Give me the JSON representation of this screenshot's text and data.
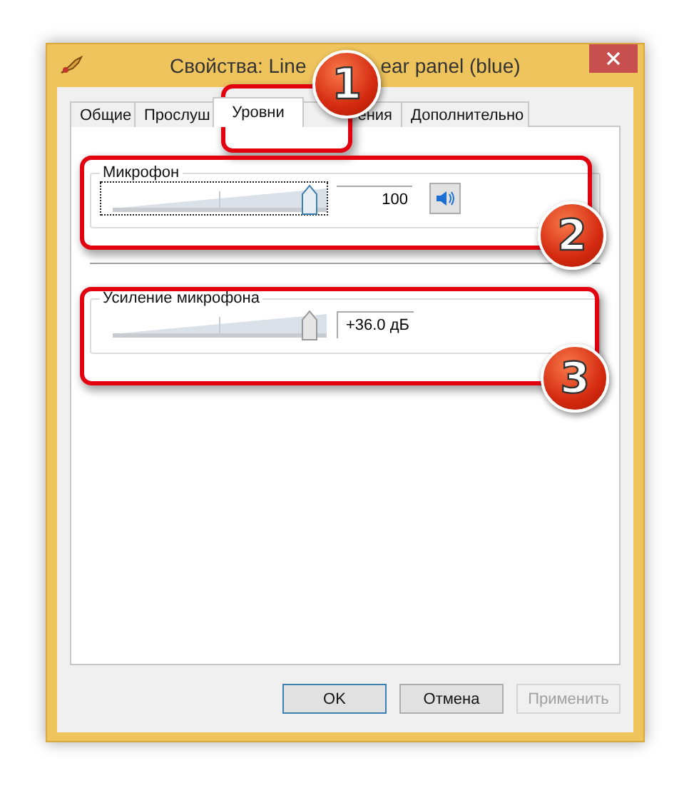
{
  "window": {
    "title_parts": [
      "Свойства: Line",
      "ear panel (blue)"
    ]
  },
  "tabs": [
    {
      "label": "Общие",
      "selected": false
    },
    {
      "label": "Прослуш",
      "selected": false
    },
    {
      "label": "Уровни",
      "selected": true
    },
    {
      "label": "ения",
      "selected": false
    },
    {
      "label": "Дополнительно",
      "selected": false
    }
  ],
  "groups": [
    {
      "label": "Микрофон",
      "kind": "volume",
      "level": 1,
      "reading": "100",
      "muted": false
    },
    {
      "label": "Усиление микрофона",
      "kind": "boost",
      "level": 1,
      "reading": "+36.0 дБ"
    }
  ],
  "buttons": [
    {
      "label": "OK",
      "disabled": false,
      "default": true
    },
    {
      "label": "Отмена",
      "disabled": false,
      "default": false
    },
    {
      "label": "Применить",
      "disabled": true,
      "default": false
    }
  ],
  "callouts": [
    {
      "number": "1"
    },
    {
      "number": "2"
    },
    {
      "number": "3"
    }
  ]
}
